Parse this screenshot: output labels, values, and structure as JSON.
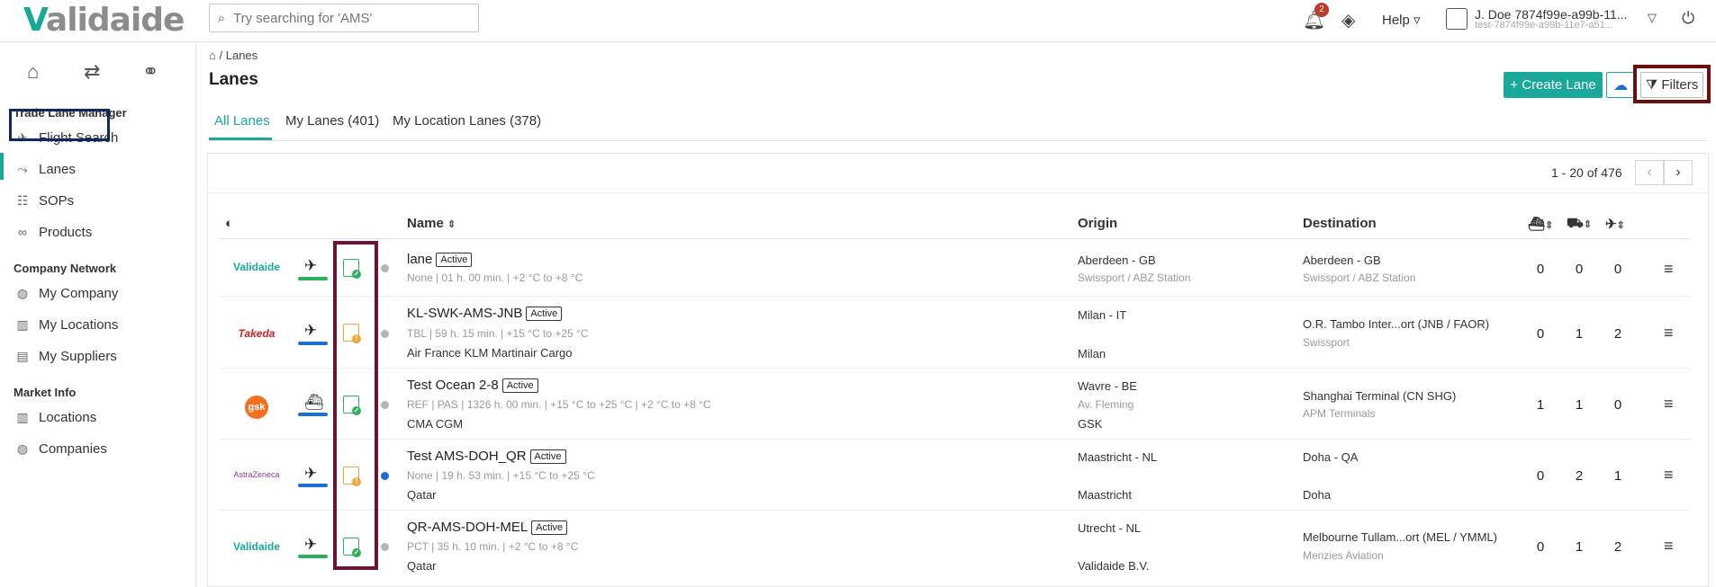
{
  "brand": {
    "logo": "alidaide",
    "logo_v": "V"
  },
  "search": {
    "placeholder": "Try searching for 'AMS'"
  },
  "header": {
    "notifications_count": "2",
    "help_label": "Help",
    "user_name": "J. Doe 7874f99e-a99b-11...",
    "user_sub": "test-7874f99e-a99b-11e7-a51..."
  },
  "sidebar": {
    "sections": [
      {
        "title": "Trade Lane Manager",
        "items": [
          "Flight Search",
          "Lanes",
          "SOPs",
          "Products"
        ]
      },
      {
        "title": "Company Network",
        "items": [
          "My Company",
          "My Locations",
          "My Suppliers"
        ]
      },
      {
        "title": "Market Info",
        "items": [
          "Locations",
          "Companies"
        ]
      }
    ]
  },
  "breadcrumb": {
    "current": "Lanes",
    "separator": "/"
  },
  "page": {
    "title": "Lanes"
  },
  "actions": {
    "create": "Create Lane",
    "filters": "Filters"
  },
  "tabs": [
    "All Lanes",
    "My Lanes (401)",
    "My Location Lanes (378)"
  ],
  "pager": {
    "range": "1 - 20 of 476"
  },
  "table": {
    "headers": {
      "name": "Name",
      "origin": "Origin",
      "destination": "Destination"
    },
    "rows": [
      {
        "logo": "Validaide",
        "mode": "air",
        "doc_status": "ok",
        "status_dot": "grey",
        "name": "lane",
        "badge": "Active",
        "meta": "None | 01 h. 00 min. | +2 °C to +8 °C",
        "carrier": "",
        "origin": "Aberdeen - GB",
        "origin_sub": "Swissport / ABZ Station",
        "origin_extra": "",
        "dest": "Aberdeen - GB",
        "dest_sub": "Swissport / ABZ Station",
        "n1": "0",
        "n2": "0",
        "n3": "0"
      },
      {
        "logo": "Takeda",
        "mode": "air",
        "doc_status": "warn",
        "status_dot": "grey",
        "name": "KL-SWK-AMS-JNB",
        "badge": "Active",
        "meta": "TBL | 59 h. 15 min. | +15 °C to +25 °C",
        "carrier": "Air France KLM Martinair Cargo",
        "origin": "Milan - IT",
        "origin_sub": "",
        "origin_extra": "Milan",
        "dest": "O.R. Tambo Inter...ort (JNB / FAOR)",
        "dest_sub": "Swissport",
        "n1": "0",
        "n2": "1",
        "n3": "2"
      },
      {
        "logo": "gsk",
        "mode": "ocean",
        "doc_status": "ok",
        "status_dot": "grey",
        "name": "Test Ocean 2-8",
        "badge": "Active",
        "meta": "REF | PAS | 1326 h. 00 min. | +15 °C to +25 °C | +2 °C to +8 °C",
        "carrier": "CMA CGM",
        "origin": "Wavre - BE",
        "origin_sub": "Av. Fleming",
        "origin_extra": "GSK",
        "dest": "Shanghai Terminal (CN SHG)",
        "dest_sub": "APM Terminals",
        "n1": "1",
        "n2": "1",
        "n3": "0"
      },
      {
        "logo": "AstraZeneca",
        "mode": "air",
        "doc_status": "warn",
        "status_dot": "blue",
        "name": "Test AMS-DOH_QR",
        "badge": "Active",
        "meta": "None | 19 h. 53 min. | +15 °C to +25 °C",
        "carrier": "Qatar",
        "origin": "Maastricht - NL",
        "origin_sub": "",
        "origin_extra": "Maastricht",
        "dest": "Doha - QA",
        "dest_sub": "",
        "dest_extra": "Doha",
        "n1": "0",
        "n2": "2",
        "n3": "1"
      },
      {
        "logo": "Validaide",
        "mode": "air",
        "doc_status": "ok",
        "status_dot": "grey",
        "name": "QR-AMS-DOH-MEL",
        "badge": "Active",
        "meta": "PCT | 35 h. 10 min. | +2 °C to +8 °C",
        "carrier": "Qatar",
        "origin": "Utrecht - NL",
        "origin_sub": "",
        "origin_extra": "Validaide B.V.",
        "dest": "Melbourne Tullam...ort (MEL / YMML)",
        "dest_sub": "Menzies Aviation",
        "n1": "0",
        "n2": "1",
        "n3": "2"
      }
    ]
  },
  "colors": {
    "brand": "#1aa89a",
    "ok": "#2fb05a",
    "warn": "#f0a63a",
    "blue": "#1a6fcf",
    "grey": "#b5b5b5"
  }
}
